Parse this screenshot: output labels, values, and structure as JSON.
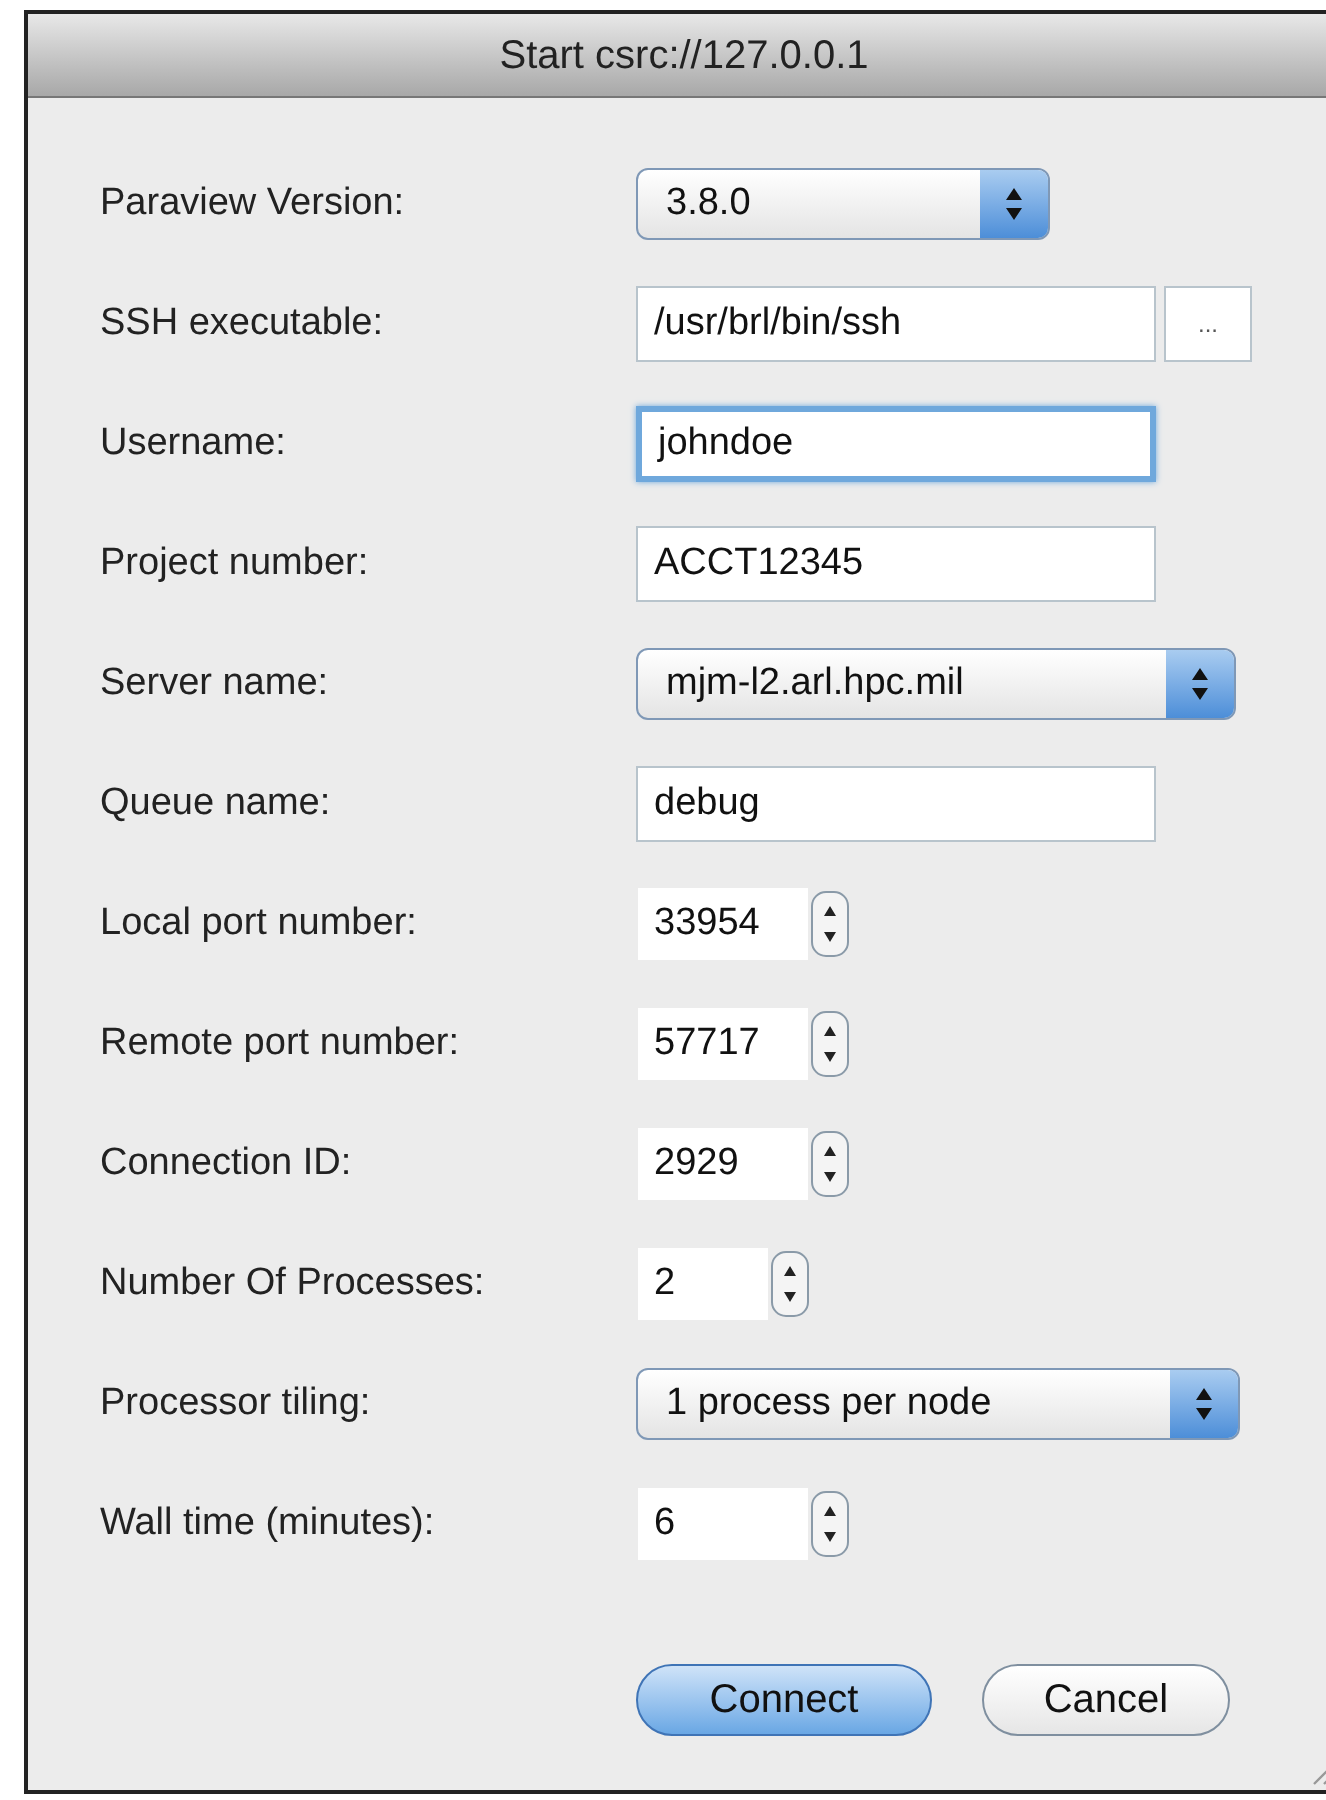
{
  "window": {
    "title": "Start csrc://127.0.0.1"
  },
  "fields": [
    {
      "label": "Paraview Version:",
      "kind": "popup",
      "value": "3.8.0",
      "focused": false
    },
    {
      "label": "SSH executable:",
      "kind": "browse",
      "value": "/usr/brl/bin/ssh",
      "button": "...",
      "focused": false
    },
    {
      "label": "Username:",
      "kind": "text",
      "value": "johndoe",
      "focused": true
    },
    {
      "label": "Project number:",
      "kind": "text",
      "value": "ACCT12345",
      "focused": false
    },
    {
      "label": "Server name:",
      "kind": "popup",
      "value": "mjm-l2.arl.hpc.mil",
      "focused": false
    },
    {
      "label": "Queue name:",
      "kind": "text",
      "value": "debug",
      "focused": false
    },
    {
      "label": "Local port number:",
      "kind": "spin",
      "value": "33954",
      "focused": false
    },
    {
      "label": "Remote port number:",
      "kind": "spin",
      "value": "57717",
      "focused": false
    },
    {
      "label": "Connection ID:",
      "kind": "spin",
      "value": "2929",
      "focused": false
    },
    {
      "label": "Number Of Processes:",
      "kind": "spin",
      "value": "2",
      "focused": false
    },
    {
      "label": "Processor tiling:",
      "kind": "popup",
      "value": "1 process per node",
      "focused": false
    },
    {
      "label": "Wall time (minutes):",
      "kind": "spin",
      "value": "6",
      "focused": false
    }
  ],
  "buttons": [
    {
      "label": "Connect",
      "default": true
    },
    {
      "label": "Cancel",
      "default": false
    }
  ]
}
